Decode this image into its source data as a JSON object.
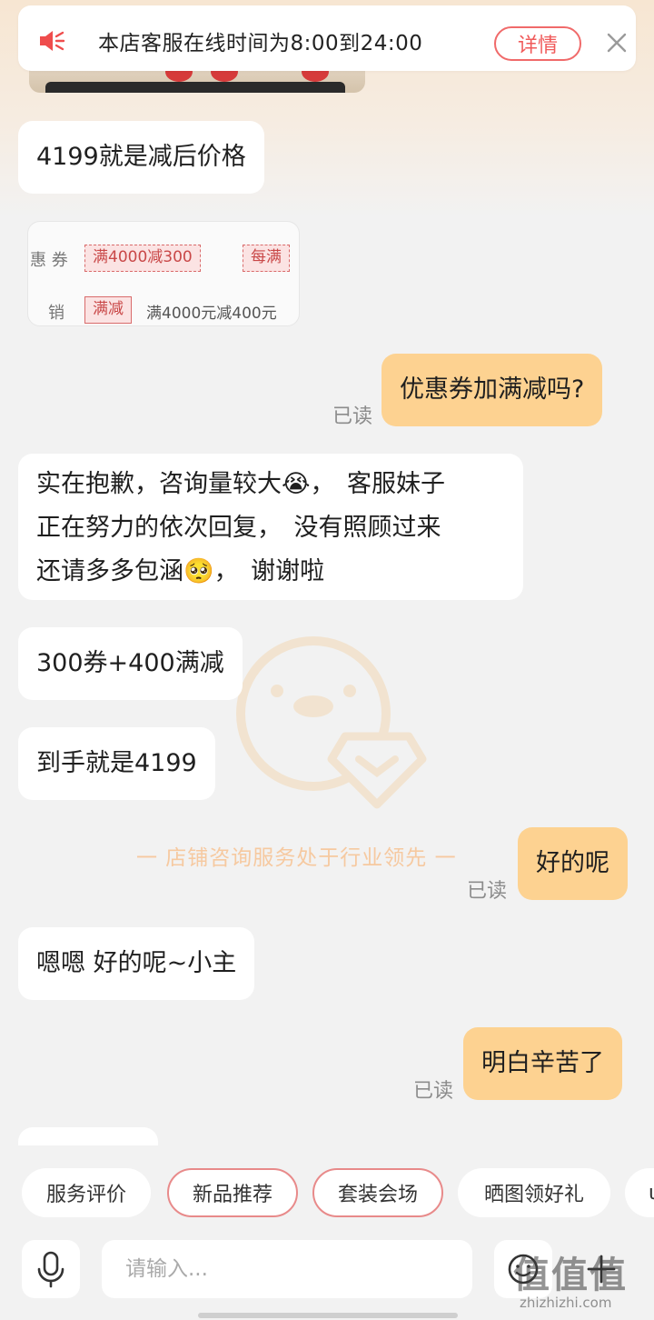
{
  "notice": {
    "text": "本店客服在线时间为8:00到24:00",
    "detail_label": "详情"
  },
  "messages": {
    "m1": "4199就是减后价格",
    "coupon": {
      "label_coupon": "惠 券",
      "label_promo": "销",
      "tag1": "满4000减300",
      "tag2": "每满",
      "tag3": "满减",
      "desc": "满4000元减400元"
    },
    "m2": "优惠券加满减吗?",
    "m2_read": "已读",
    "m3_line1": "实在抱歉，咨询量较大😭，　客服妹子",
    "m3_line2": "正在努力的依次回复，　没有照顾过来",
    "m3_line3": "还请多多包涵🥺，　谢谢啦",
    "m4": "300券+400满减",
    "m5": "到手就是4199",
    "m6": "好的呢",
    "m6_read": "已读",
    "m7": "嗯嗯  好的呢~小主",
    "m8": "明白辛苦了",
    "m8_read": "已读"
  },
  "watermark": {
    "text": "一  店铺咨询服务处于行业领先  一"
  },
  "chips": [
    "服务评价",
    "新品推荐",
    "套装会场",
    "晒图领好礼",
    "ι"
  ],
  "input": {
    "placeholder": "请输入..."
  },
  "site_watermark": {
    "logo": "值值值",
    "url": "zhizhizhi.com"
  },
  "colors": {
    "accent_bubble": "#fdd291",
    "notice_red": "#f05a5a",
    "background": "#f2f2f2"
  },
  "icons": {
    "notice": "speaker-icon",
    "close": "close-icon",
    "mic": "microphone-icon",
    "emoji": "emoji-icon",
    "plus": "plus-icon"
  }
}
